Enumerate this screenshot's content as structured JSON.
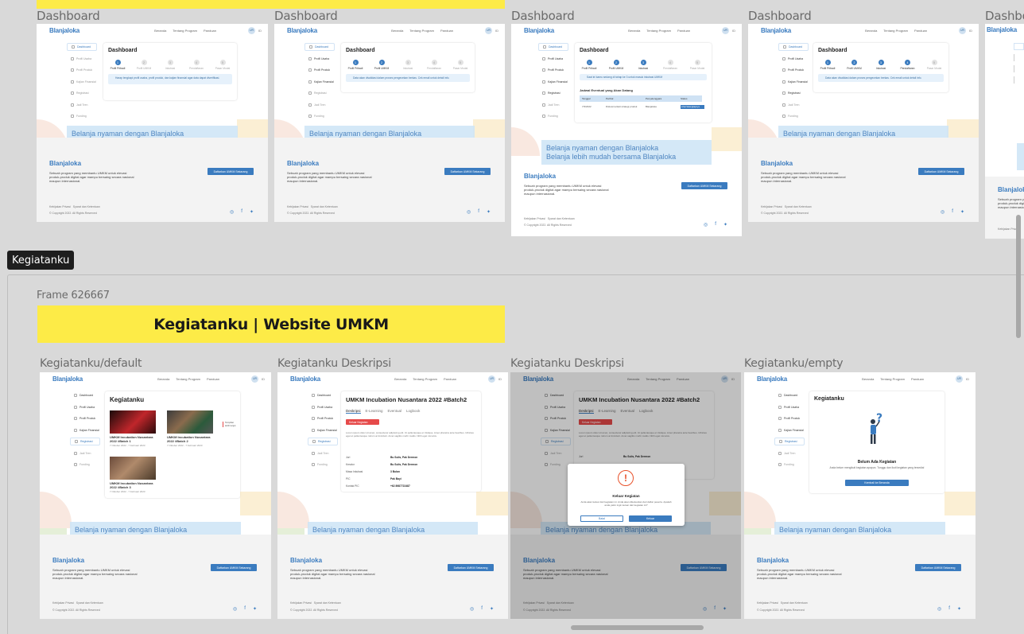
{
  "section": {
    "tag": "Kegiatanku",
    "frame_label": "Frame 626667",
    "header_title": "Kegiatanku | Website UMKM"
  },
  "top_frames": [
    {
      "label": "Dashboard"
    },
    {
      "label": "Dashboard"
    },
    {
      "label": "Dashboard"
    },
    {
      "label": "Dashboard"
    },
    {
      "label": "Dashboard"
    }
  ],
  "bottom_frames": [
    {
      "label": "Kegiatanku/default"
    },
    {
      "label": "Kegiatanku Deskripsi"
    },
    {
      "label": "Kegiatanku Deskripsi"
    },
    {
      "label": "Kegiatanku/empty"
    }
  ],
  "nav": {
    "logo": "Blanjaloka",
    "links": [
      "Beranda",
      "Tentang Program",
      "Panduan"
    ],
    "avatar": "UR",
    "lang": "ID"
  },
  "sidebar_items": [
    "Dashboard",
    "Profil Usaha",
    "Profil Produk",
    "Kajian Finansial",
    "Registrasi",
    "Jadi Tren",
    "Funding"
  ],
  "dashboard": {
    "title": "Dashboard",
    "steps": [
      "Profil Pribadi",
      "Profil UMKM",
      "Inkubasi",
      "Pendaftaran",
      "Pasar Modal"
    ],
    "alert_1": "Harap lengkapi profil usaha, profil produk, dan kajian finansial agar data dapat diverifikasi.",
    "alert_2": "Data akan divalidasi dalam proses pengecekan berkas. Cek email untuk detail info.",
    "alert_3": "Saat ini kamu sedang di tahap ke 3 untuk masuk inkubasi UMKM",
    "schedule_title": "Jadwal Eventual yang Akan Datang",
    "schedule_headers": [
      "Tanggal",
      "Perihal",
      "Penyelenggara",
      "Status"
    ],
    "schedule_row": [
      "7/3/2022",
      "Diskusi terkait strategi produk",
      "Blanjaloka",
      "Lihat Selengkapnya"
    ]
  },
  "banner": {
    "line1": "Belanja nyaman dengan Blanjaloka",
    "line2": "Belanja lebih mudah bersama Blanjaloka"
  },
  "footer": {
    "logo": "Blanjaloka",
    "desc": "Sebuah program yang membantu UMKM untuk elevasi produk-produk digital agar mampu bersaing secara nasional maupun internasional.",
    "cta": "Daftarkan UMKM Sekarang",
    "legal_1": "Kebijakan Privasi",
    "legal_2": "Syarat dan Ketentuan",
    "copyright": "© Copyright 2022. All Rights Reserved"
  },
  "kegiatanku": {
    "title": "Kegiatanku",
    "events": [
      {
        "title": "UMKM Incubation Nusantara 2022 #Batch 1",
        "date": "7 Oktober 2022 - 7 Februari 2023"
      },
      {
        "title": "UMKM Incubation Nusantara 2022 #Batch 2",
        "date": "7 Oktober 2022 - 7 Februari 2023"
      },
      {
        "title": "UMKM Incubation Nusantara 2022 #Batch 3",
        "date": "7 Oktober 2022 - 7 Februari 2023"
      }
    ],
    "side_note": "Tampilan lebih lanjut"
  },
  "deskripsi": {
    "title": "UMKM Incubation Nusantara 2022 #Batch2",
    "tabs": [
      "Deskripsi",
      "E-Learning",
      "Eventual",
      "Logbook"
    ],
    "exit_btn": "Keluar Kegiatan",
    "paragraph": "Lorem ipsum dolor sit amet, consectetur adipiscing elit. Ut pellentesque et tristique. Amet pharetra ante faucibus. Ultricies eget et pellentesque rutrum at tincidunt. Amet sagittis morbi mattis. Nibh eget nisi arcu.",
    "kv": [
      [
        "Juri",
        "Bu Sulis, Pak Dermon"
      ],
      [
        "Kreator",
        "Bu Sulis, Pak Dermon"
      ],
      [
        "Masa Inkubasi",
        "3 Bulan"
      ],
      [
        "PIC",
        "Pak Bayi"
      ],
      [
        "Kontak PIC",
        "+62 8987722487"
      ]
    ]
  },
  "modal": {
    "title": "Keluar Kegiatan",
    "text": "Anda akan keluar dari kegiatan ini. Anda akan dikeluarkan dari daftar peserta. Apakah anda yakin ingin keluar dari kegiatan ini?",
    "cancel": "Batal",
    "confirm": "Keluar",
    "icon_glyph": "!"
  },
  "empty": {
    "title": "Kegiatanku",
    "heading": "Belum Ada Kegiatan",
    "text": "Anda belum mengikuti kegiatan apapun. Tunggu dan ikuti kegiatan yang tersedia!",
    "btn": "Kembali ke Beranda"
  },
  "colors": {
    "brand": "#3a7bbf",
    "accent_yellow": "#fdeb47",
    "danger": "#e64a4a"
  }
}
